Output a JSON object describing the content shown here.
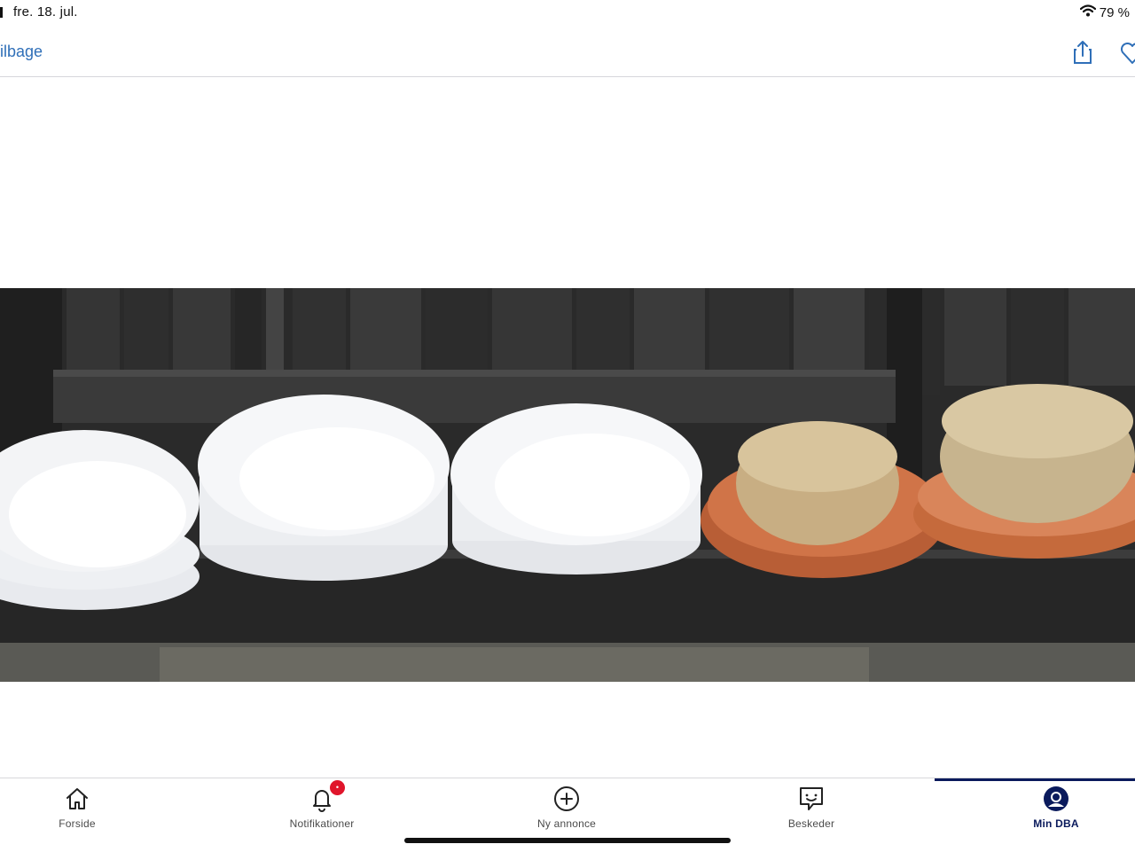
{
  "status_bar": {
    "date": "fre. 18. jul.",
    "battery": "79 %",
    "icons": [
      "wifi-icon",
      "battery-icon"
    ]
  },
  "nav": {
    "back_label": "ilbage",
    "icons": [
      "share-icon",
      "heart-icon"
    ],
    "link_color": "#2f6fb8"
  },
  "photo": {
    "content": "bowls-and-plant-saucers-on-bench"
  },
  "tabbar": {
    "active_color": "#0a1a5c",
    "badge_color": "#e0152b",
    "badge": "•",
    "items": [
      {
        "label": "Forside",
        "icon": "home-icon"
      },
      {
        "label": "Notifikationer",
        "icon": "bell-icon"
      },
      {
        "label": "Ny annonce",
        "icon": "plus-circle-icon"
      },
      {
        "label": "Beskeder",
        "icon": "chat-icon"
      },
      {
        "label": "Min DBA",
        "icon": "profile-icon"
      }
    ]
  }
}
